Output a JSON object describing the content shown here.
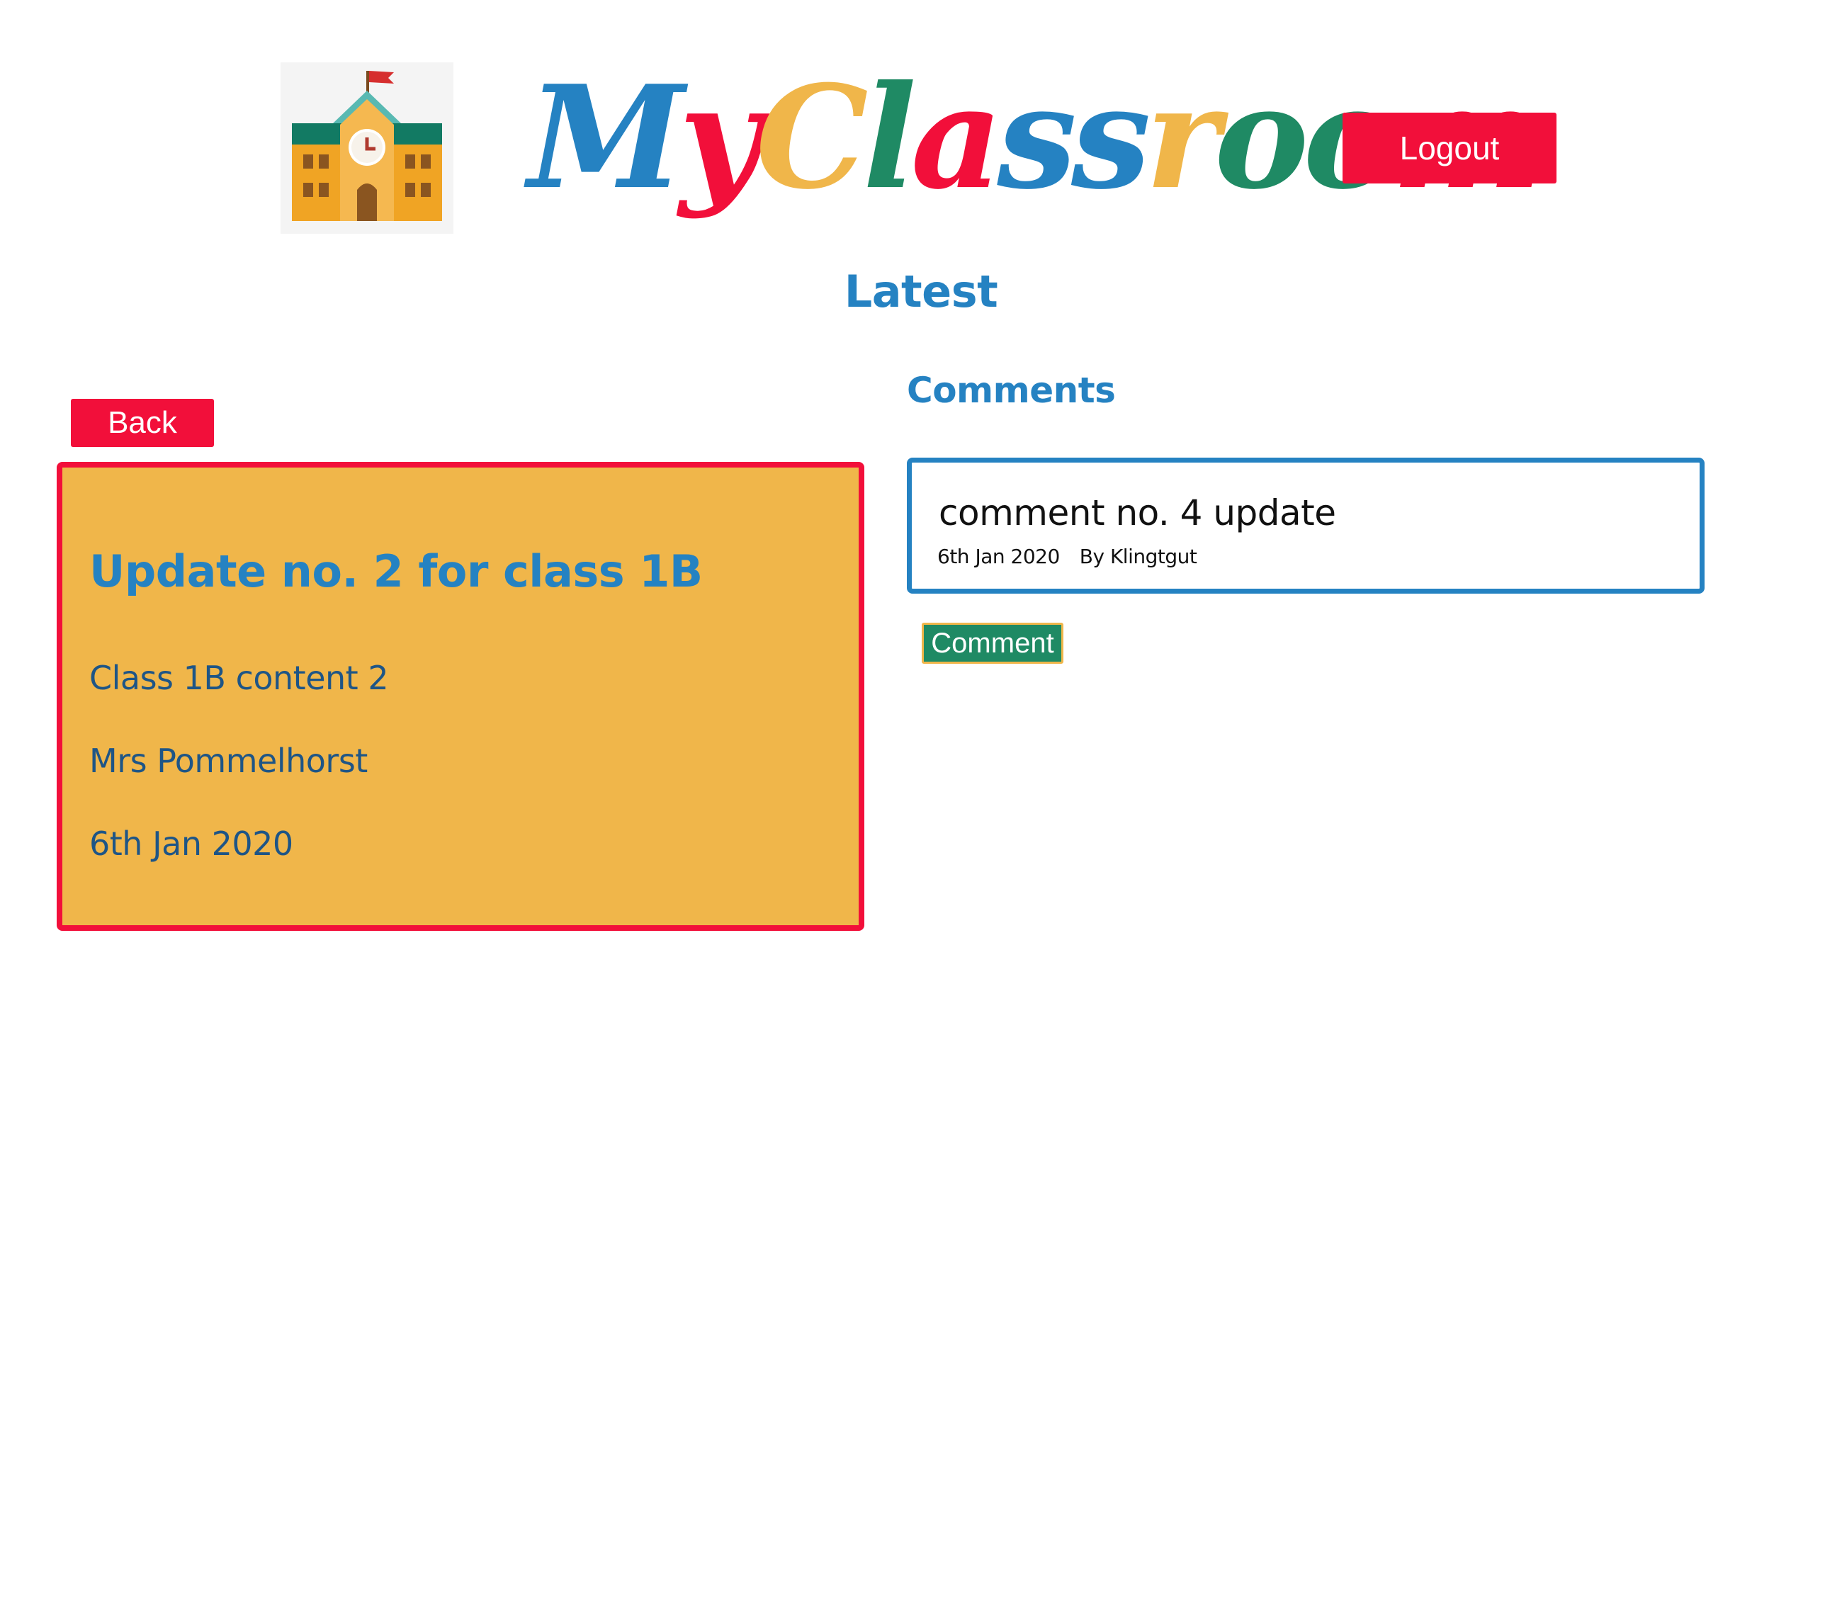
{
  "header": {
    "brand_letters": [
      {
        "char": "M",
        "color": "#2582c2"
      },
      {
        "char": "y",
        "color": "#f20f3a"
      },
      {
        "char": "C",
        "color": "#f0b64a"
      },
      {
        "char": "l",
        "color": "#1f8a64"
      },
      {
        "char": "a",
        "color": "#f20f3a"
      },
      {
        "char": "s",
        "color": "#2582c2"
      },
      {
        "char": "s",
        "color": "#2582c2"
      },
      {
        "char": "r",
        "color": "#f0b64a"
      },
      {
        "char": "o",
        "color": "#1f8a64"
      },
      {
        "char": "o",
        "color": "#1f8a64"
      },
      {
        "char": "m",
        "color": "#f20f3a"
      }
    ],
    "logo_icon": "school-building-icon",
    "logout_label": "Logout"
  },
  "page": {
    "heading": "Latest"
  },
  "update": {
    "back_label": "Back",
    "title": "Update no. 2 for class 1B",
    "content": "Class 1B content 2",
    "author": "Mrs Pommelhorst",
    "date": "6th Jan 2020"
  },
  "comments": {
    "heading": "Comments",
    "items": [
      {
        "text": "comment no. 4 update",
        "date": "6th Jan 2020",
        "author": "By Klingtgut"
      }
    ],
    "comment_button_label": "Comment"
  },
  "colors": {
    "red": "#f20f3a",
    "blue": "#2582c2",
    "yellow": "#f0b64a",
    "green": "#1f8a64",
    "navy": "#1e5586"
  }
}
